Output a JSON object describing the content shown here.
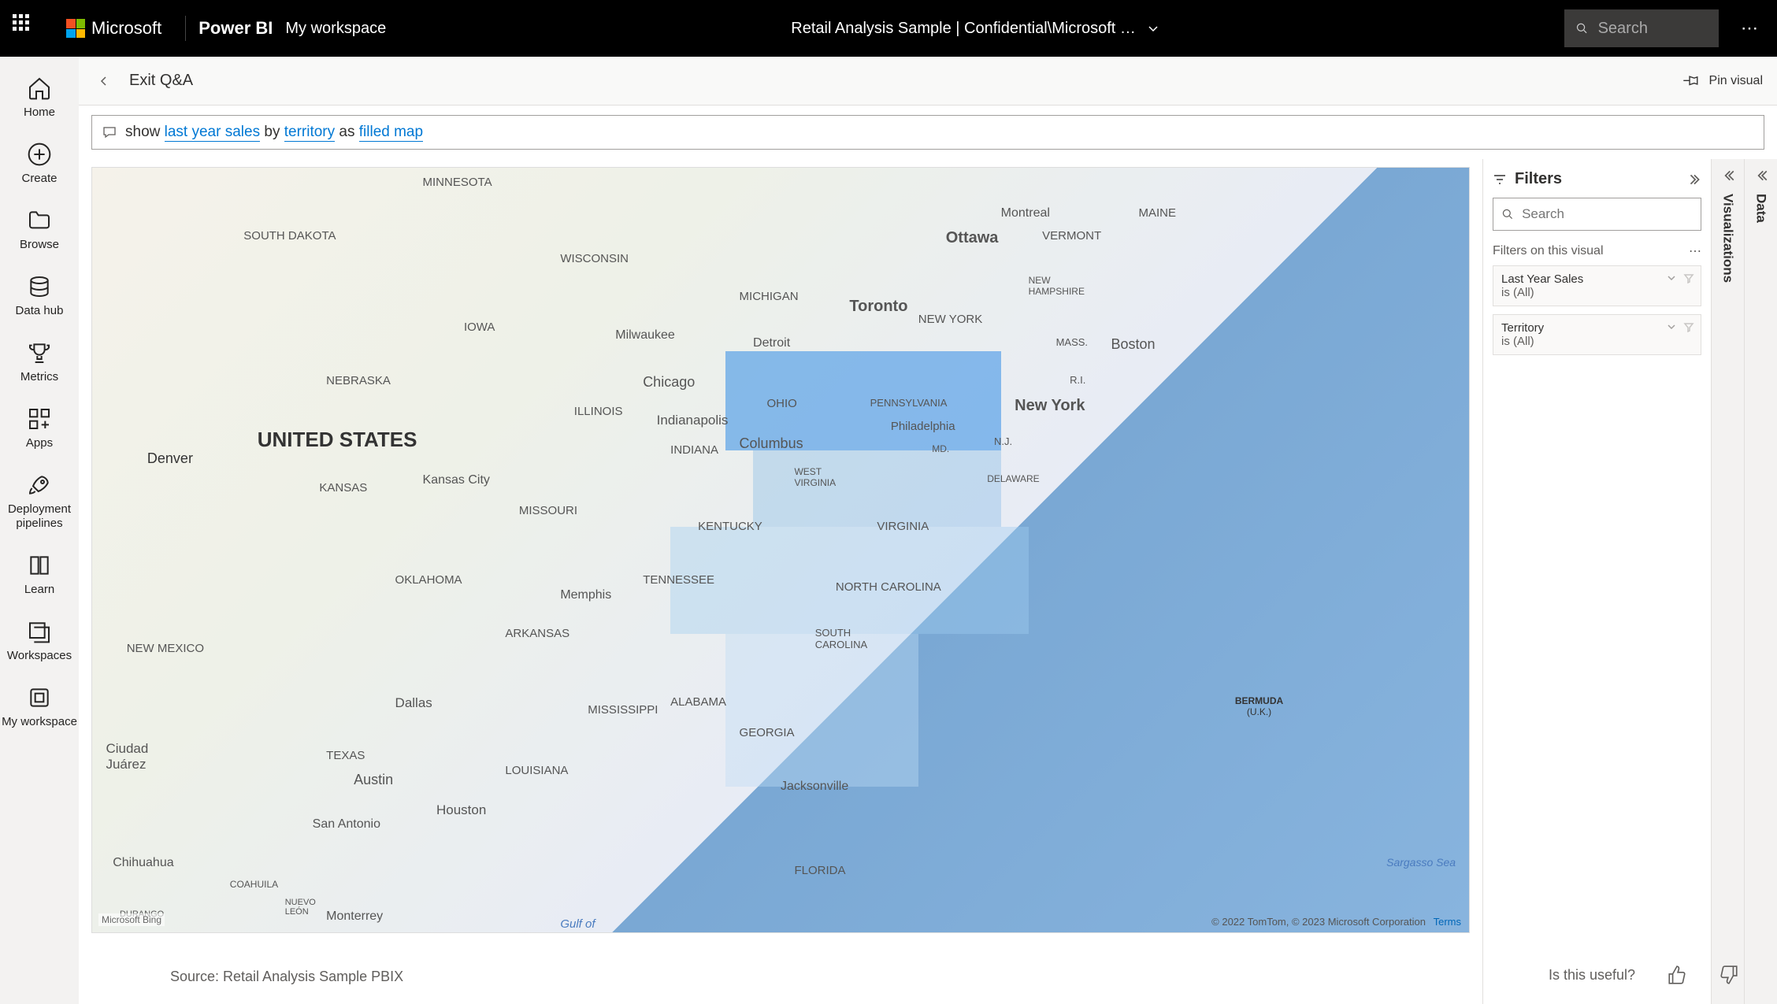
{
  "header": {
    "brand_ms": "Microsoft",
    "brand_app": "Power BI",
    "workspace": "My workspace",
    "center_title": "Retail Analysis Sample  |  Confidential\\Microsoft …",
    "search_placeholder": "Search"
  },
  "nav": [
    {
      "label": "Home",
      "icon": "home-icon"
    },
    {
      "label": "Create",
      "icon": "plus-circle-icon"
    },
    {
      "label": "Browse",
      "icon": "folder-icon"
    },
    {
      "label": "Data hub",
      "icon": "data-hub-icon"
    },
    {
      "label": "Metrics",
      "icon": "trophy-icon"
    },
    {
      "label": "Apps",
      "icon": "apps-icon"
    },
    {
      "label": "Deployment pipelines",
      "icon": "rocket-icon"
    },
    {
      "label": "Learn",
      "icon": "book-icon"
    },
    {
      "label": "Workspaces",
      "icon": "workspaces-icon"
    },
    {
      "label": "My workspace",
      "icon": "my-workspace-icon"
    }
  ],
  "subheader": {
    "exit_label": "Exit Q&A",
    "pin_label": "Pin visual"
  },
  "qna": {
    "prefix": "show ",
    "measure": "last year sales",
    "by": " by ",
    "dimension": "territory",
    "as": " as ",
    "visual": "filled map"
  },
  "filters": {
    "title": "Filters",
    "search_placeholder": "Search",
    "section_title": "Filters on this visual",
    "cards": [
      {
        "name": "Last Year Sales",
        "value": "is (All)"
      },
      {
        "name": "Territory",
        "value": "is (All)"
      }
    ]
  },
  "collapsed_panels": {
    "visualizations": "Visualizations",
    "data": "Data"
  },
  "map": {
    "country_label": "UNITED STATES",
    "places": {
      "minnesota": "MINNESOTA",
      "wisconsin": "WISCONSIN",
      "michigan": "MICHIGAN",
      "iowa": "IOWA",
      "nebraska": "NEBRASKA",
      "south_dakota": "SOUTH DAKOTA",
      "illinois": "ILLINOIS",
      "indiana": "INDIANA",
      "ohio": "OHIO",
      "kentucky": "KENTUCKY",
      "tennessee": "TENNESSEE",
      "missouri": "MISSOURI",
      "kansas": "KANSAS",
      "oklahoma": "OKLAHOMA",
      "arkansas": "ARKANSAS",
      "texas": "TEXAS",
      "louisiana": "LOUISIANA",
      "mississippi": "MISSISSIPPI",
      "alabama": "ALABAMA",
      "georgia": "GEORGIA",
      "florida": "FLORIDA",
      "south_carolina": "SOUTH\nCAROLINA",
      "north_carolina": "NORTH CAROLINA",
      "virginia": "VIRGINIA",
      "west_virginia": "WEST\nVIRGINIA",
      "pennsylvania": "PENNSYLVANIA",
      "new_york_state": "NEW YORK",
      "maine": "MAINE",
      "vermont": "VERMONT",
      "new_hampshire": "NEW\nHAMPSHIRE",
      "mass": "MASS.",
      "ri": "R.I.",
      "nj": "N.J.",
      "md": "MD.",
      "delaware": "DELAWARE",
      "new_mexico": "NEW MEXICO",
      "coahuila": "COAHUILA",
      "nuevo_leon": "NUEVO\nLEÓN",
      "durango": "DURANGO"
    },
    "cities": {
      "denver": "Denver",
      "chicago": "Chicago",
      "milwaukee": "Milwaukee",
      "indianapolis": "Indianapolis",
      "columbus": "Columbus",
      "detroit": "Detroit",
      "toronto": "Toronto",
      "ottawa": "Ottawa",
      "montreal": "Montreal",
      "boston": "Boston",
      "new_york": "New York",
      "philadelphia": "Philadelphia",
      "kansas_city": "Kansas City",
      "dallas": "Dallas",
      "austin": "Austin",
      "houston": "Houston",
      "san_antonio": "San Antonio",
      "memphis": "Memphis",
      "jacksonville": "Jacksonville",
      "monterrey": "Monterrey",
      "ciudad_juarez": "Ciudad\nJuárez",
      "chihuahua": "Chihuahua"
    },
    "bermuda_label": "BERMUDA",
    "bermuda_sub": "(U.K.)",
    "sargasso": "Sargasso Sea",
    "gulf": "Gulf of",
    "attrib": "© 2022 TomTom, © 2023 Microsoft Corporation",
    "terms": "Terms",
    "bing": "Microsoft Bing"
  },
  "footer": {
    "source": "Source: Retail Analysis Sample PBIX",
    "useful": "Is this useful?"
  }
}
